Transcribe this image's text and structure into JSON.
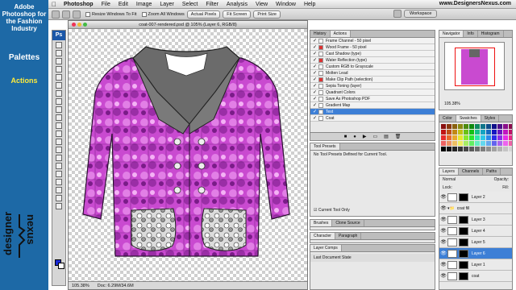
{
  "sidebar": {
    "brand": "Adobe Photoshop for the Fashion Industry",
    "section": "Palettes",
    "subsection": "Actions"
  },
  "menubar": {
    "items": [
      "Photoshop",
      "File",
      "Edit",
      "Image",
      "Layer",
      "Select",
      "Filter",
      "Analysis",
      "View",
      "Window",
      "Help"
    ],
    "url": "www.DesignersNexus.com"
  },
  "options": {
    "resize_windows": "Resize Windows To Fit",
    "zoom_all": "Zoom All Windows",
    "actual_pixels": "Actual Pixels",
    "fit_screen": "Fit Screen",
    "print_size": "Print Size",
    "workspace": "Workspace"
  },
  "document": {
    "title": "coat-007-rendered.psd @ 105% (Layer 6, RGB/8)",
    "zoom": "105.38%",
    "doc_size": "Doc: 6.29M/34.6M"
  },
  "history_panel": {
    "tabs": [
      "History",
      "Actions"
    ]
  },
  "actions": [
    {
      "label": "Frame Channel - 50 pixel",
      "dialog": false
    },
    {
      "label": "Wood Frame - 50 pixel",
      "dialog": true
    },
    {
      "label": "Cast Shadow (type)",
      "dialog": false
    },
    {
      "label": "Water Reflection (type)",
      "dialog": true
    },
    {
      "label": "Custom RGB to Grayscale",
      "dialog": false
    },
    {
      "label": "Molten Lead",
      "dialog": false
    },
    {
      "label": "Make Clip Path (selection)",
      "dialog": true
    },
    {
      "label": "Sepia Toning (layer)",
      "dialog": false
    },
    {
      "label": "Quadrant Colors",
      "dialog": false
    },
    {
      "label": "Save As Photoshop PDF",
      "dialog": false
    },
    {
      "label": "Gradient Map",
      "dialog": false
    },
    {
      "label": "Test",
      "dialog": false,
      "selected": true
    },
    {
      "label": "Coat",
      "dialog": false
    }
  ],
  "tool_presets": {
    "title": "Tool Presets",
    "empty": "No Tool Presets Defined for Current Tool.",
    "current_tool_only": "Current Tool Only"
  },
  "brushes_tabs": [
    "Brushes",
    "Clone Source"
  ],
  "character_tabs": [
    "Character",
    "Paragraph"
  ],
  "layer_comps": {
    "title": "Layer Comps",
    "item": "Last Document State"
  },
  "navigator": {
    "tabs": [
      "Navigator",
      "Info",
      "Histogram"
    ],
    "zoom": "105.38%"
  },
  "swatches_tabs": [
    "Color",
    "Swatches",
    "Styles"
  ],
  "layers_panel": {
    "tabs": [
      "Layers",
      "Channels",
      "Paths"
    ],
    "blend": "Normal",
    "opacity_label": "Opacity:",
    "lock_label": "Lock:",
    "fill_label": "Fill:"
  },
  "layers": [
    {
      "name": "Layer 2",
      "group": false,
      "selected": false
    },
    {
      "name": "coat fill",
      "group": true,
      "selected": false
    },
    {
      "name": "Layer 3",
      "group": false,
      "selected": false
    },
    {
      "name": "Layer 4",
      "group": false,
      "selected": false
    },
    {
      "name": "Layer 5",
      "group": false,
      "selected": false
    },
    {
      "name": "Layer 6",
      "group": false,
      "selected": true
    },
    {
      "name": "Layer 1",
      "group": false,
      "selected": false
    },
    {
      "name": "coat",
      "group": false,
      "selected": false
    }
  ],
  "logo": {
    "line1": "designers",
    "line2": "nexus"
  },
  "colors": {
    "accent": "#1d69a6",
    "subheading": "#ffeb3b",
    "selection": "#3d7fd6",
    "coat": "#c94ad0",
    "collar": "#6b6b6b"
  }
}
